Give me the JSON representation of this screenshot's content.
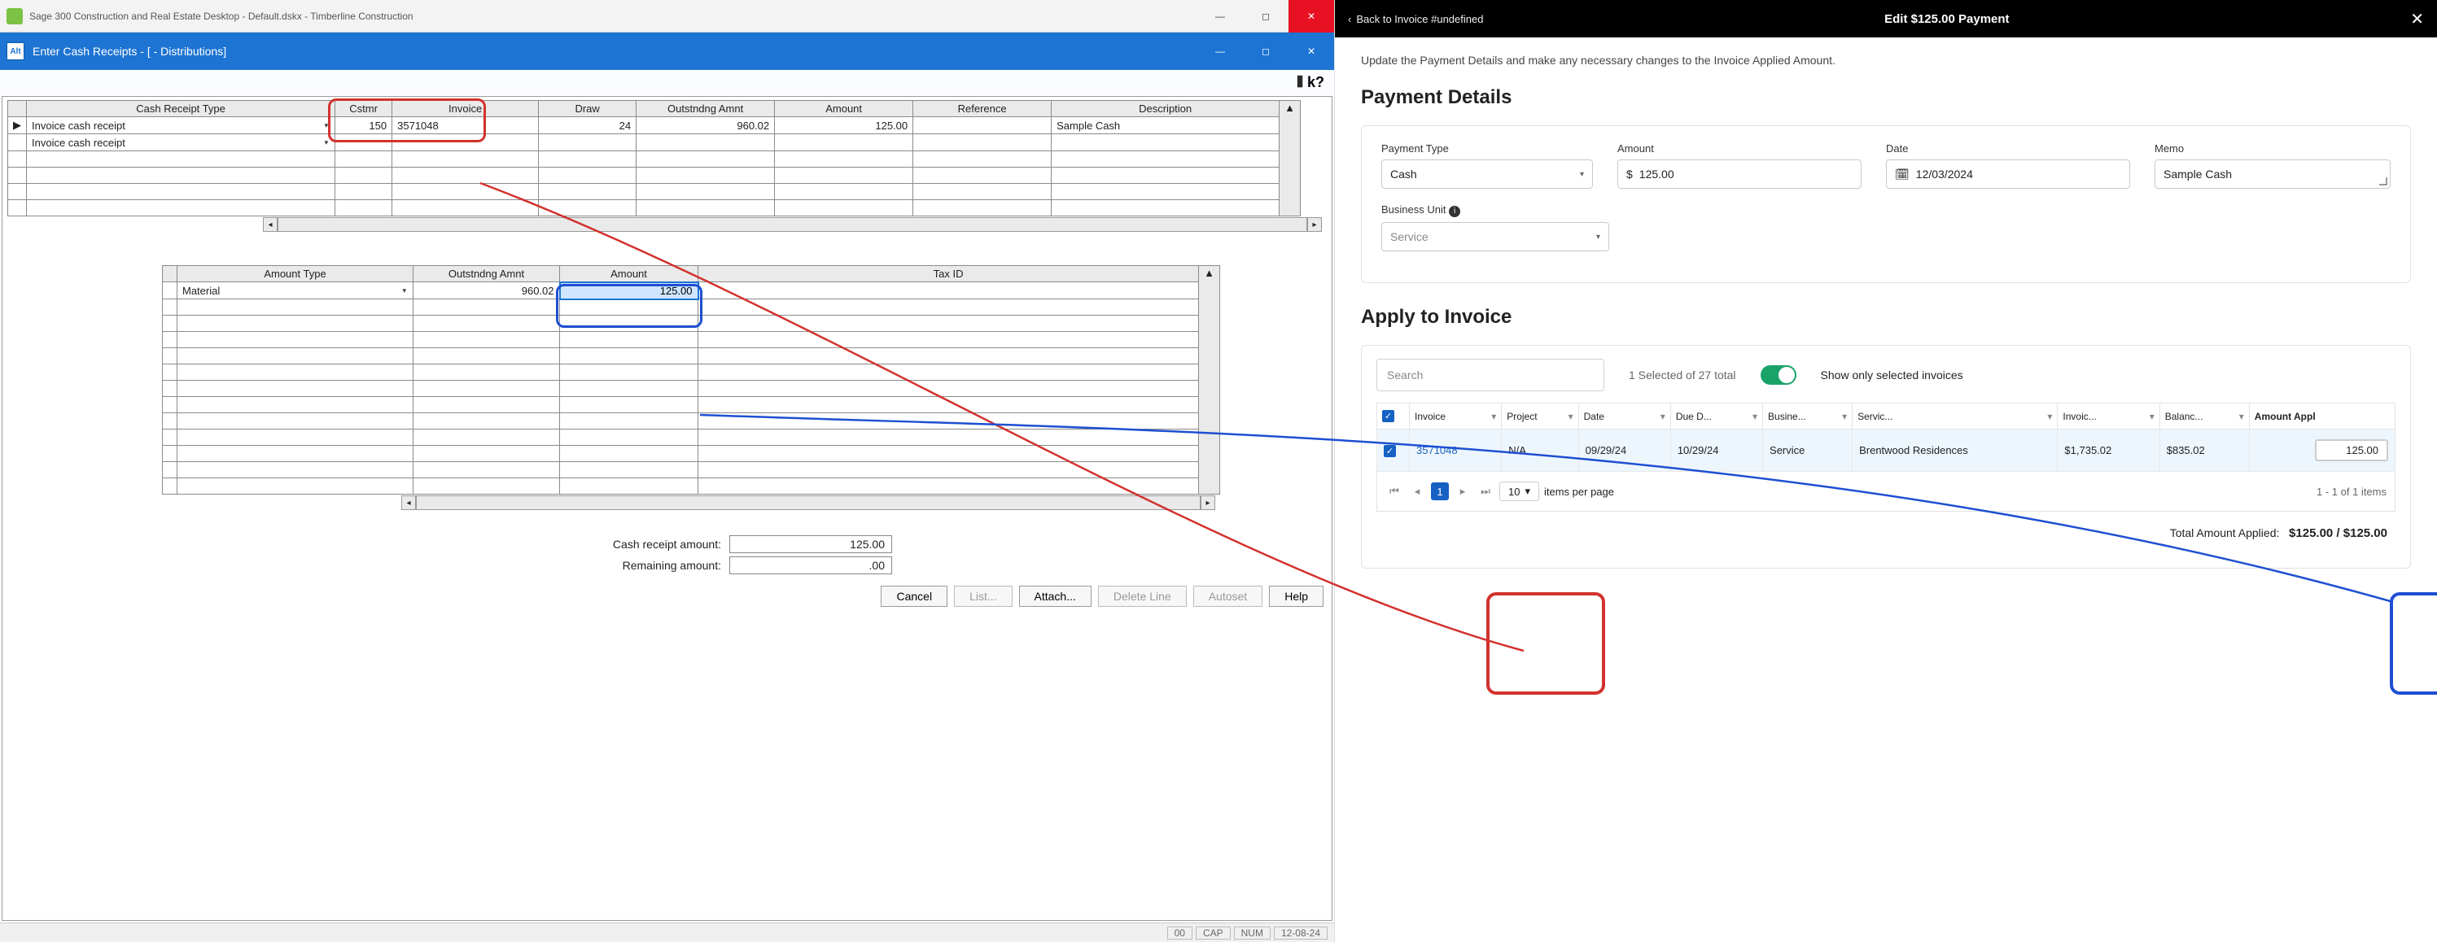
{
  "sage": {
    "titlebar": "Sage 300 Construction and Real Estate Desktop - Default.dskx - Timberline Construction",
    "subwindow": "Enter Cash Receipts - [ - Distributions]",
    "grid": {
      "headers": [
        "Cash Receipt Type",
        "Cstmr",
        "Invoice",
        "Draw",
        "Outstndng Amnt",
        "Amount",
        "Reference",
        "Description"
      ],
      "row": {
        "type": "Invoice cash receipt",
        "cstmr": "150",
        "invoice": "3571048",
        "draw": "24",
        "outstanding": "960.02",
        "amount": "125.00",
        "reference": "",
        "description": "Sample Cash"
      },
      "row2_type": "Invoice cash receipt"
    },
    "amtgrid": {
      "headers": [
        "Amount Type",
        "Outstndng Amnt",
        "Amount",
        "Tax ID"
      ],
      "row": {
        "type": "Material",
        "outstanding": "960.02",
        "amount": "125.00",
        "tax": ""
      }
    },
    "totals": {
      "cash_label": "Cash receipt amount:",
      "cash_val": "125.00",
      "rem_label": "Remaining amount:",
      "rem_val": ".00"
    },
    "buttons": {
      "cancel": "Cancel",
      "list": "List...",
      "attach": "Attach...",
      "delete": "Delete Line",
      "autoset": "Autoset",
      "help": "Help"
    },
    "status": {
      "s1": "00",
      "s2": "CAP",
      "s3": "NUM",
      "s4": "12-08-24"
    }
  },
  "web": {
    "back": "Back to Invoice #undefined",
    "title": "Edit $125.00 Payment",
    "desc": "Update the Payment Details and make any necessary changes to the Invoice Applied Amount.",
    "h_details": "Payment Details",
    "fields": {
      "ptype_label": "Payment Type",
      "ptype_val": "Cash",
      "amount_label": "Amount",
      "amount_val": "125.00",
      "date_label": "Date",
      "date_val": "12/03/2024",
      "memo_label": "Memo",
      "memo_val": "Sample Cash",
      "bu_label": "Business Unit",
      "bu_val": "Service"
    },
    "h_apply": "Apply to Invoice",
    "search_ph": "Search",
    "sel_text": "1 Selected of 27 total",
    "show_sel": "Show only selected invoices",
    "inv_headers": [
      "Invoice",
      "Project",
      "Date",
      "Due D...",
      "Busine...",
      "Servic...",
      "Invoic...",
      "Balanc...",
      "Amount Appl"
    ],
    "inv_row": {
      "invoice": "3571048",
      "project": "N/A",
      "date": "09/29/24",
      "due": "10/29/24",
      "busunit": "Service",
      "servloc": "Brentwood Residences",
      "invamt": "$1,735.02",
      "balance": "$835.02",
      "applied": "125.00"
    },
    "pager": {
      "page": "1",
      "size": "10",
      "per": "items per page",
      "info": "1 - 1 of 1 items"
    },
    "total_label": "Total Amount Applied:",
    "total_val": "$125.00 / $125.00"
  }
}
